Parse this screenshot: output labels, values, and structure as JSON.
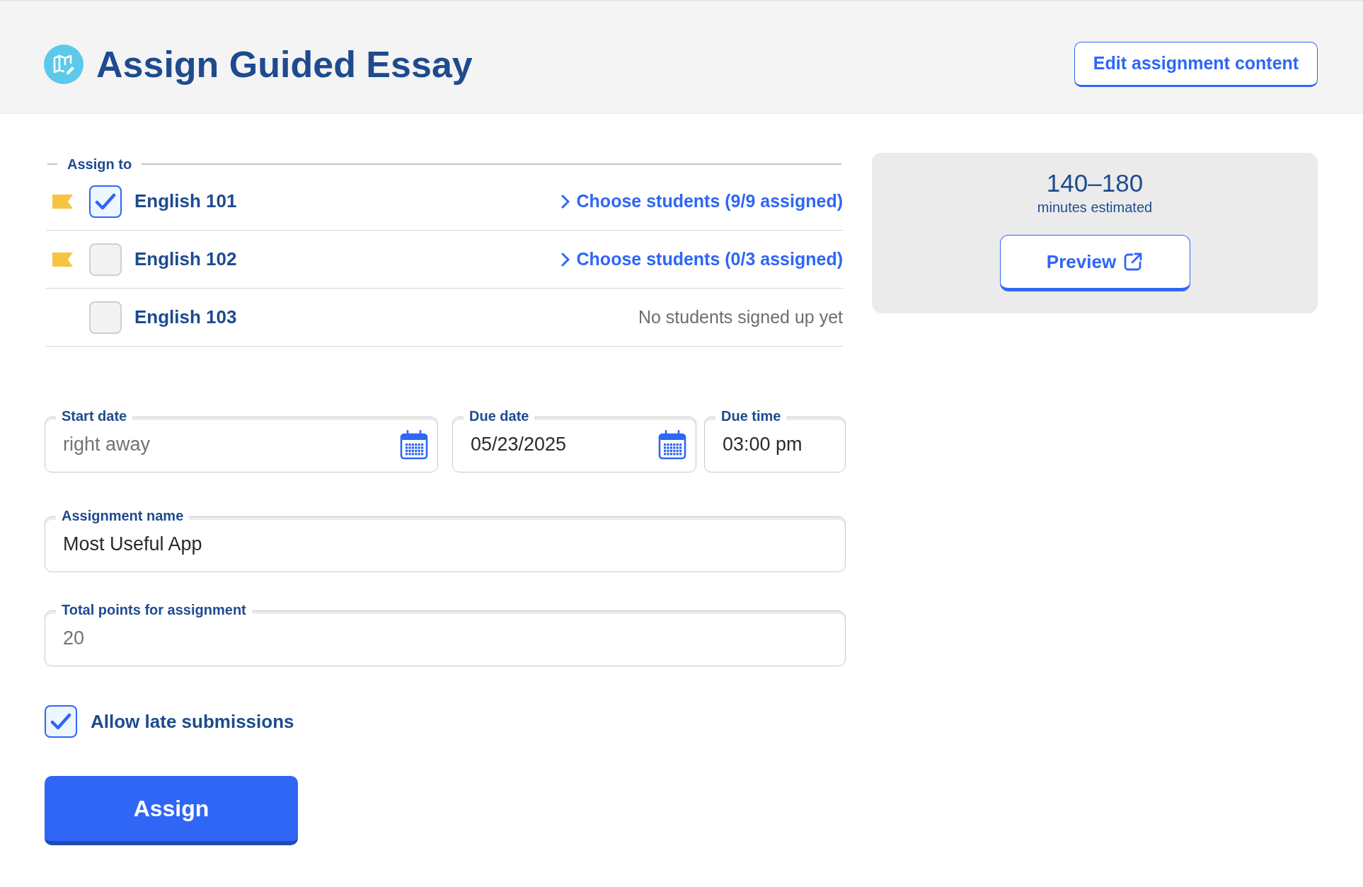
{
  "header": {
    "title": "Assign Guided Essay",
    "edit_button": "Edit assignment content"
  },
  "assign_to": {
    "legend": "Assign to",
    "classes": [
      {
        "name": "English 101",
        "flag": true,
        "checked": true,
        "kind": "link",
        "action": "Choose students (9/9 assigned)"
      },
      {
        "name": "English 102",
        "flag": true,
        "checked": false,
        "kind": "link",
        "action": "Choose students (0/3 assigned)"
      },
      {
        "name": "English 103",
        "flag": false,
        "checked": false,
        "kind": "note",
        "action": "No students signed up yet"
      }
    ]
  },
  "schedule": [
    {
      "kind": "date",
      "label": "Start date",
      "placeholder": "right away"
    },
    {
      "kind": "date",
      "label": "Due date",
      "value": "05/23/2025"
    },
    {
      "kind": "time",
      "label": "Due time",
      "value": "03:00 pm"
    }
  ],
  "assignment_name": {
    "label": "Assignment name",
    "value": "Most Useful App"
  },
  "total_points": {
    "label": "Total points for assignment",
    "placeholder": "20"
  },
  "allow_late": {
    "label": "Allow late submissions",
    "checked": true
  },
  "assign_button": "Assign",
  "estimate": {
    "range": "140–180",
    "caption": "minutes estimated",
    "preview_button": "Preview"
  }
}
